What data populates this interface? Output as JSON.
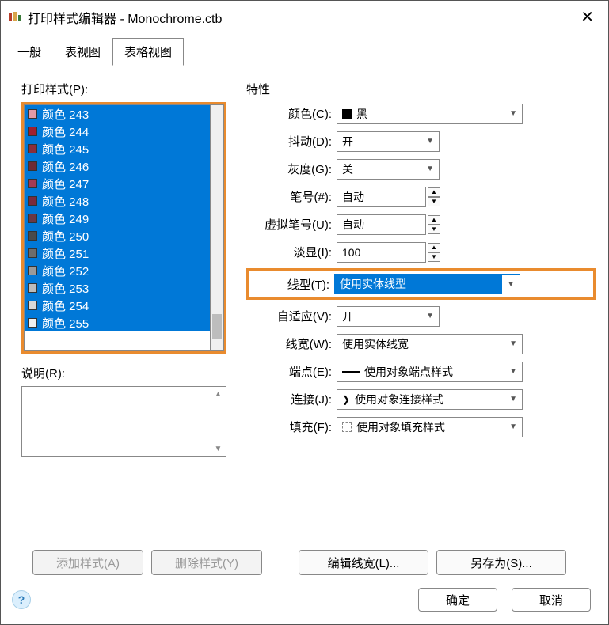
{
  "window": {
    "title": "打印样式编辑器 - Monochrome.ctb"
  },
  "tabs": {
    "items": [
      "一般",
      "表视图",
      "表格视图"
    ],
    "active": "表格视图"
  },
  "left": {
    "styles_label": "打印样式(P):",
    "desc_label": "说明(R):",
    "items": [
      {
        "label": "颜色 243",
        "swatch": "#e29aa7"
      },
      {
        "label": "颜色 244",
        "swatch": "#a02030"
      },
      {
        "label": "颜色 245",
        "swatch": "#8b2e3a"
      },
      {
        "label": "颜色 246",
        "swatch": "#6e2b36"
      },
      {
        "label": "颜色 247",
        "swatch": "#a43b55"
      },
      {
        "label": "颜色 248",
        "swatch": "#7a2a3d"
      },
      {
        "label": "颜色 249",
        "swatch": "#6b3844"
      },
      {
        "label": "颜色 250",
        "swatch": "#4a4a4a"
      },
      {
        "label": "颜色 251",
        "swatch": "#6d6d6d"
      },
      {
        "label": "颜色 252",
        "swatch": "#9a9a9a"
      },
      {
        "label": "颜色 253",
        "swatch": "#bcbcbc"
      },
      {
        "label": "颜色 254",
        "swatch": "#d8d8d8"
      },
      {
        "label": "颜色 255",
        "swatch": "#f0f0f0"
      }
    ]
  },
  "right": {
    "section_label": "特性",
    "color": {
      "label": "颜色(C):",
      "value": "黑"
    },
    "dither": {
      "label": "抖动(D):",
      "value": "开"
    },
    "gray": {
      "label": "灰度(G):",
      "value": "关"
    },
    "pen": {
      "label": "笔号(#):",
      "value": "自动"
    },
    "vpen": {
      "label": "虚拟笔号(U):",
      "value": "自动"
    },
    "fade": {
      "label": "淡显(I):",
      "value": "100"
    },
    "linetype": {
      "label": "线型(T):",
      "value": "使用实体线型"
    },
    "adaptive": {
      "label": "自适应(V):",
      "value": "开"
    },
    "lineweight": {
      "label": "线宽(W):",
      "value": "使用实体线宽"
    },
    "endcap": {
      "label": "端点(E):",
      "value": "使用对象端点样式"
    },
    "join": {
      "label": "连接(J):",
      "value": "使用对象连接样式"
    },
    "fill": {
      "label": "填充(F):",
      "value": "使用对象填充样式"
    }
  },
  "buttons": {
    "add": "添加样式(A)",
    "delete": "删除样式(Y)",
    "edit_lw": "编辑线宽(L)...",
    "save_as": "另存为(S)...",
    "ok": "确定",
    "cancel": "取消"
  }
}
